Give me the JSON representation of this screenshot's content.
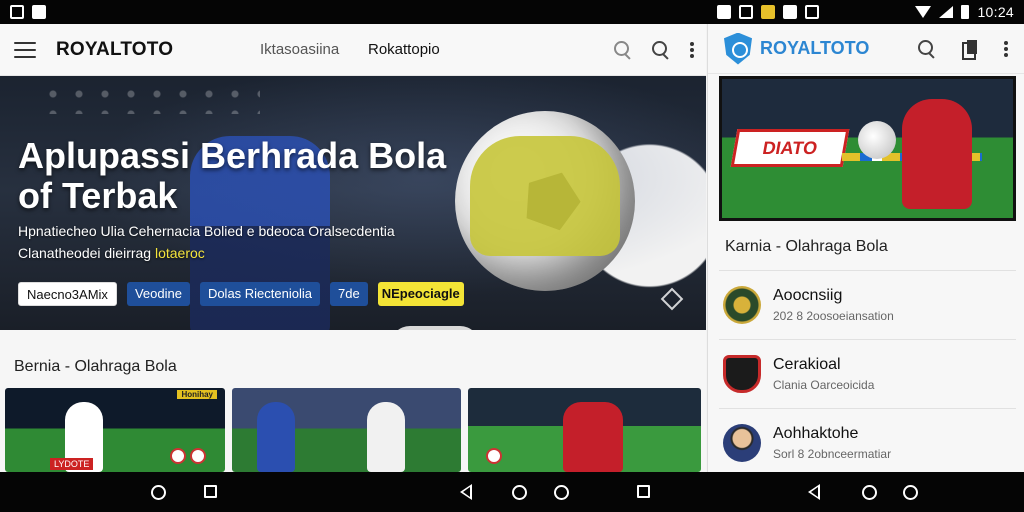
{
  "status_bar": {
    "time": "10:24"
  },
  "left_app": {
    "brand": "ROYALTOTO",
    "nav_links": [
      "Iktasoasiina",
      "Rokattopio"
    ],
    "hero": {
      "title": "Aplupassi Berhrada Bola of Terbak",
      "subtitle_line1": "Hpnatiecheo Ulia Cehernacia Bolied e bdeoca Oralsecdentia",
      "subtitle_line2": "Clanatheodei dieirrag ",
      "subtitle_highlight": "lotaeroc",
      "chips": [
        "Naecno3AMix",
        "Veodine",
        "Dolas Riecteniolia",
        "7de",
        "NEpeociagle"
      ]
    },
    "section_title": "Bernia - Olahraga Bola",
    "thumbnails": [
      {
        "badge": "LYDOTE",
        "top_badge": "Honihay"
      },
      {
        "badge": ""
      },
      {
        "badge": ""
      }
    ]
  },
  "right_app": {
    "brand": "ROYALTOTO",
    "hero_banner": "DIATO",
    "section_title": "Karnia - Olahraga Bola",
    "items": [
      {
        "title": "Aoocnsiig",
        "subtitle": "202 8 2oosoeiansation"
      },
      {
        "title": "Cerakioal",
        "subtitle": "Clania Oarceoicida"
      },
      {
        "title": "Aohhaktohe",
        "subtitle": "Sorl 8 2obnceermatiar"
      }
    ]
  },
  "colors": {
    "brand_blue": "#2c86d2",
    "chip_blue": "#1f4f9a",
    "highlight_yellow": "#f3e436",
    "status_bar": "#050505"
  }
}
